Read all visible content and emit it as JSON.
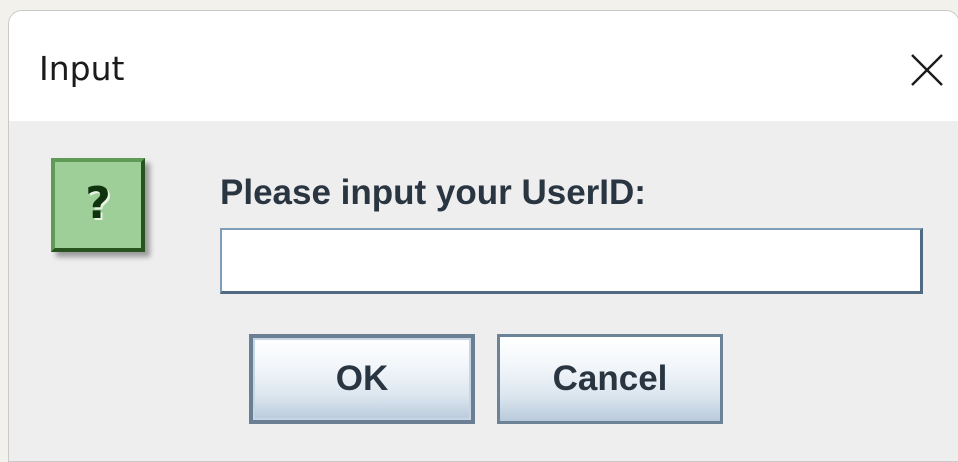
{
  "dialog": {
    "title": "Input",
    "close_icon": "close-icon",
    "icon": "question-icon",
    "icon_glyph": "?",
    "message": "Please input your UserID:",
    "input_value": "",
    "ok_label": "OK",
    "cancel_label": "Cancel"
  },
  "colors": {
    "icon_background": "#9fcf98",
    "button_border": "#6c8297",
    "text": "#2a3542"
  }
}
